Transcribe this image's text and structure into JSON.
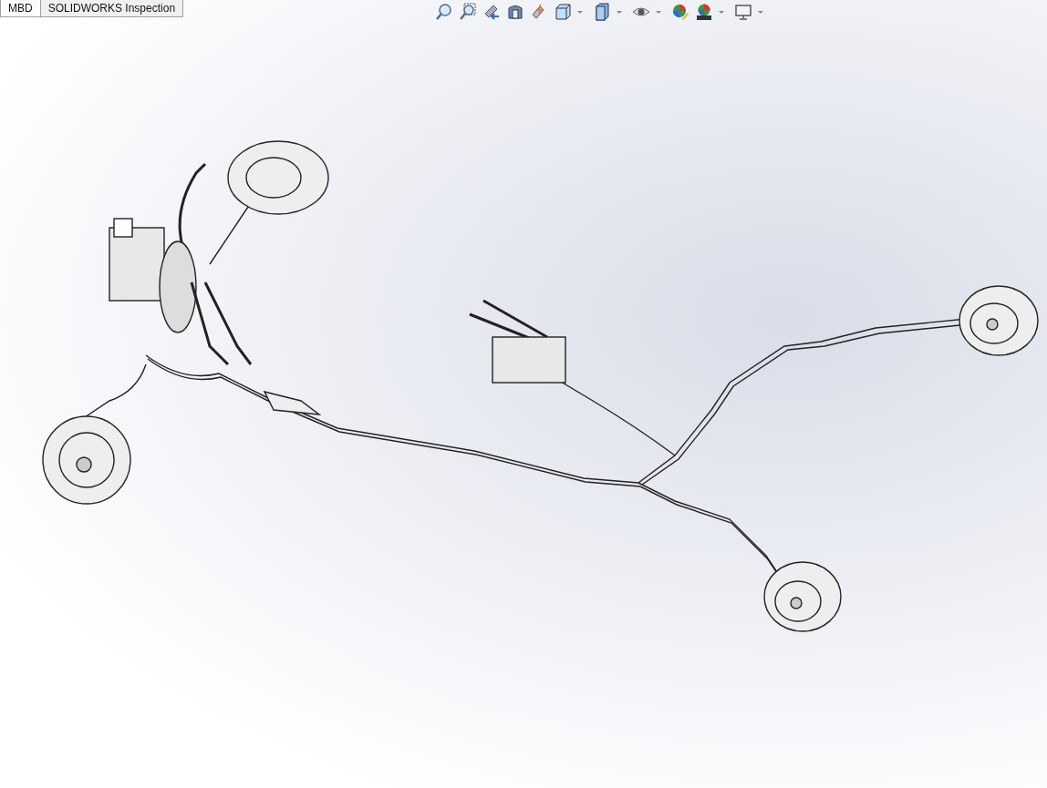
{
  "tabs": [
    {
      "label": "MBD",
      "selected": true
    },
    {
      "label": "SOLIDWORKS Inspection",
      "selected": false
    }
  ]
}
